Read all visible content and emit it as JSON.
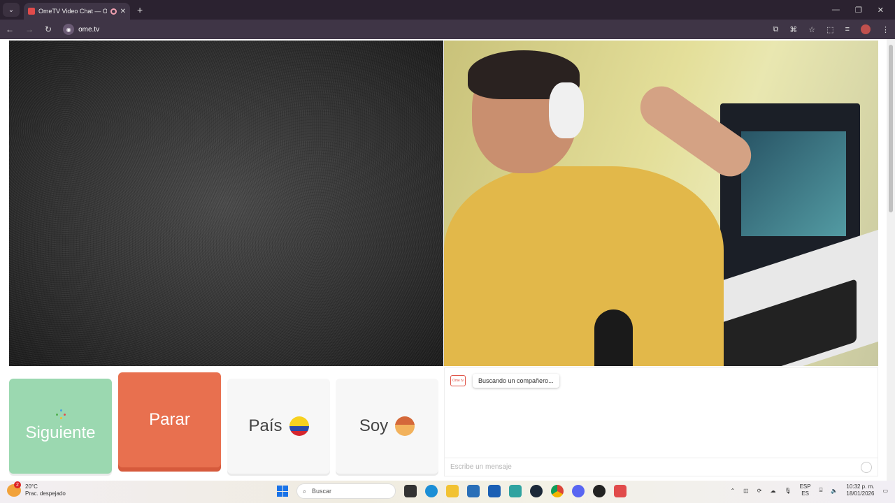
{
  "browser": {
    "tab_title": "OmeTV Video Chat — Ome",
    "url": "ome.tv"
  },
  "page": {
    "buttons": {
      "next": "Siguiente",
      "stop": "Parar",
      "country": "País",
      "gender": "Soy"
    },
    "chat": {
      "logo_text": "Ome tv",
      "status_message": "Buscando un compañero...",
      "input_placeholder": "Escribe un mensaje"
    }
  },
  "taskbar": {
    "weather_temp": "20°C",
    "weather_desc": "Prac. despejado",
    "weather_badge": "2",
    "search_placeholder": "Buscar",
    "language_top": "ESP",
    "language_bottom": "ES",
    "time": "10:32 p. m.",
    "date": "18/01/2026"
  },
  "colors": {
    "next_button": "#9bd8b0",
    "stop_button": "#e8704f",
    "option_button": "#f7f7f7",
    "accent": "#e0564a"
  }
}
